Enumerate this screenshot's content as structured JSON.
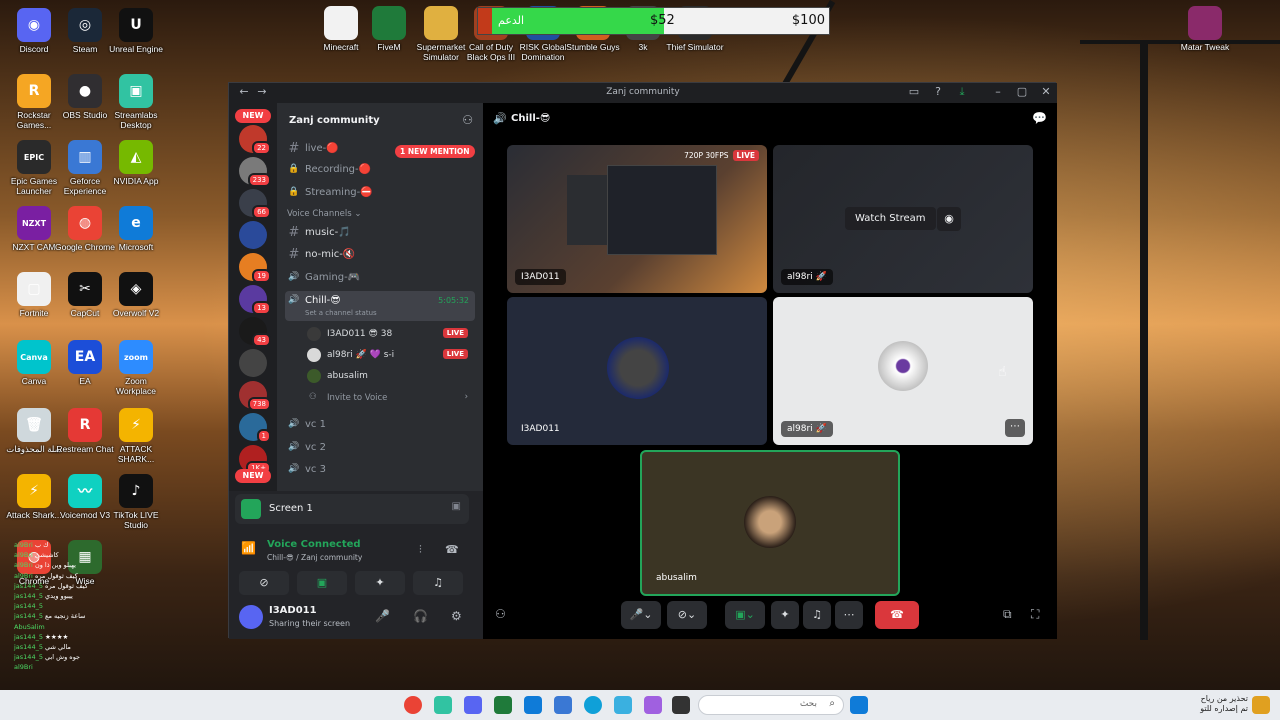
{
  "desktop": {
    "icons": [
      {
        "label": "Discord",
        "color": "#5865f2",
        "glyph": "◉"
      },
      {
        "label": "Steam",
        "color": "#1b2838",
        "glyph": "◎"
      },
      {
        "label": "Unreal Engine",
        "color": "#111111",
        "glyph": "U"
      },
      {
        "label": "Rockstar Games...",
        "color": "#f5a623",
        "glyph": "R"
      },
      {
        "label": "OBS Studio",
        "color": "#302e31",
        "glyph": "●"
      },
      {
        "label": "Streamlabs Desktop",
        "color": "#31c3a2",
        "glyph": "▣"
      },
      {
        "label": "Epic Games Launcher",
        "color": "#2a2a2a",
        "glyph": "EPIC"
      },
      {
        "label": "Geforce Experience",
        "color": "#3a78d4",
        "glyph": "▥"
      },
      {
        "label": "NVIDIA App",
        "color": "#76b900",
        "glyph": "◭"
      },
      {
        "label": "NZXT CAM",
        "color": "#7a1fa2",
        "glyph": "NZXT"
      },
      {
        "label": "Google Chrome",
        "color": "#ea4335",
        "glyph": "◍"
      },
      {
        "label": "Microsoft",
        "color": "#0f7bd8",
        "glyph": "e"
      },
      {
        "label": "Fortnite",
        "color": "#f0f0f0",
        "glyph": "▢"
      },
      {
        "label": "CapCut",
        "color": "#111111",
        "glyph": "✂"
      },
      {
        "label": "Overwolf V2",
        "color": "#111111",
        "glyph": "◈"
      },
      {
        "label": "Canva",
        "color": "#00c4cc",
        "glyph": "Canva"
      },
      {
        "label": "EA",
        "color": "#1c4ed8",
        "glyph": "EA"
      },
      {
        "label": "Zoom Workplace",
        "color": "#2d8cff",
        "glyph": "zoom"
      },
      {
        "label": "سلة المحذوفات",
        "color": "#cfd8dc",
        "glyph": "🗑"
      },
      {
        "label": "Restream Chat",
        "color": "#e53935",
        "glyph": "R"
      },
      {
        "label": "ATTACK SHARK...",
        "color": "#f4b400",
        "glyph": "⚡"
      },
      {
        "label": "Attack Shark...",
        "color": "#f4b400",
        "glyph": "⚡"
      },
      {
        "label": "Voicemod V3",
        "color": "#0fd1c1",
        "glyph": "〰"
      },
      {
        "label": "TikTok LIVE Studio",
        "color": "#111111",
        "glyph": "♪"
      },
      {
        "label": "Chrome",
        "color": "#ea4335",
        "glyph": "◍"
      },
      {
        "label": "Wise",
        "color": "#2d6a2d",
        "glyph": "▦"
      }
    ],
    "top_icons": [
      {
        "label": "Minecraft",
        "color": "#f2f2f2"
      },
      {
        "label": "FiveM",
        "color": "#1f7a3a"
      },
      {
        "label": "Supermarket Simulator",
        "color": "#e0b040"
      },
      {
        "label": "Call of Duty Black Ops III",
        "color": "#a04020"
      },
      {
        "label": "RISK Global Domination",
        "color": "#2050a0"
      },
      {
        "label": "Stumble Guys",
        "color": "#d06020"
      },
      {
        "label": "3k",
        "color": "#444444"
      },
      {
        "label": "Thief Simulator",
        "color": "#2a2a2a"
      }
    ],
    "winrar": {
      "label": "Matar Tweak",
      "color": "#8a2a6a"
    }
  },
  "donation": {
    "label": "الدعم",
    "current": "$52",
    "goal": "$100",
    "progress": 0.52
  },
  "discord": {
    "window_title": "Zanj community",
    "server_name": "Zanj community",
    "new_mention": "1 NEW MENTION",
    "channels_top": [
      {
        "name": "live-🔴",
        "icon": "#"
      },
      {
        "name": "Recording-🔴",
        "icon": "🔒"
      },
      {
        "name": "Streaming-⛔",
        "icon": "🔒"
      }
    ],
    "voice_category": "Voice Channels",
    "voice_channels": [
      {
        "name": "music-🎵",
        "icon": "#"
      },
      {
        "name": "no-mic-🔇",
        "icon": "#"
      },
      {
        "name": "Gaming-🎮",
        "icon": "🔊"
      }
    ],
    "active_channel": {
      "name": "Chill-😎",
      "timer": "5:05:32",
      "status": "Set a channel status"
    },
    "voice_users": [
      {
        "name": "I3AD011",
        "extra": "😎 38",
        "live": "LIVE",
        "color": "#3a3a3a"
      },
      {
        "name": "al98ri 🚀",
        "extra": "💜 s-i",
        "live": "LIVE",
        "color": "#d9d9d9"
      },
      {
        "name": "abusalim",
        "extra": "",
        "live": "",
        "color": "#3c5a2a"
      }
    ],
    "invite": "Invite to Voice",
    "other_channels": [
      "vc 1",
      "vc 2",
      "vc 3"
    ],
    "guild_badges": [
      "22",
      "233",
      "66",
      "",
      "19",
      "13",
      "43",
      "",
      "738",
      "1",
      "1K+"
    ],
    "new_label": "NEW",
    "screen_card": "Screen 1",
    "voice_connected": "Voice Connected",
    "voice_connected_sub": "Chill-😎 / Zanj community",
    "user": {
      "name": "I3AD011",
      "status": "Sharing their screen"
    },
    "stage_title": "Chill-😎",
    "tiles": {
      "stream1": {
        "name": "I3AD011",
        "quality": "720P 30FPS",
        "live": "LIVE"
      },
      "stream2": {
        "name": "al98ri 🚀",
        "watch": "Watch Stream"
      },
      "cam1": {
        "name": "I3AD011"
      },
      "cam2": {
        "name": "al98ri 🚀"
      },
      "cam3": {
        "name": "abusalim"
      }
    }
  },
  "taskbar": {
    "search_placeholder": "بحث",
    "tray_line1": "تحذير من رياح",
    "tray_line2": "تم إصداره للتو"
  },
  "chat_overlay": [
    {
      "name": "al9Bri",
      "text": "ك ب"
    },
    {
      "name": "al9Bri",
      "text": "كاشيشي"
    },
    {
      "name": "al9Bri",
      "text": "يهبلو وين ذا ون"
    },
    {
      "name": "al9Bri",
      "text": "كيف ثوقول مره"
    },
    {
      "name": "jas144_5",
      "text": "كيف ثوقول مره"
    },
    {
      "name": "jas144_5",
      "text": "ييبوو ويدي"
    },
    {
      "name": "jas144_5",
      "text": ""
    },
    {
      "name": "jas144_5",
      "text": "ساعة زنجيه مع"
    },
    {
      "name": "AbuSalim",
      "text": ""
    },
    {
      "name": "jas144_5",
      "text": "★★★★"
    },
    {
      "name": "jas144_5",
      "text": "مالي شي"
    },
    {
      "name": "jas144_5",
      "text": "جوه وش ابي"
    },
    {
      "name": "al9Bri",
      "text": ""
    }
  ]
}
